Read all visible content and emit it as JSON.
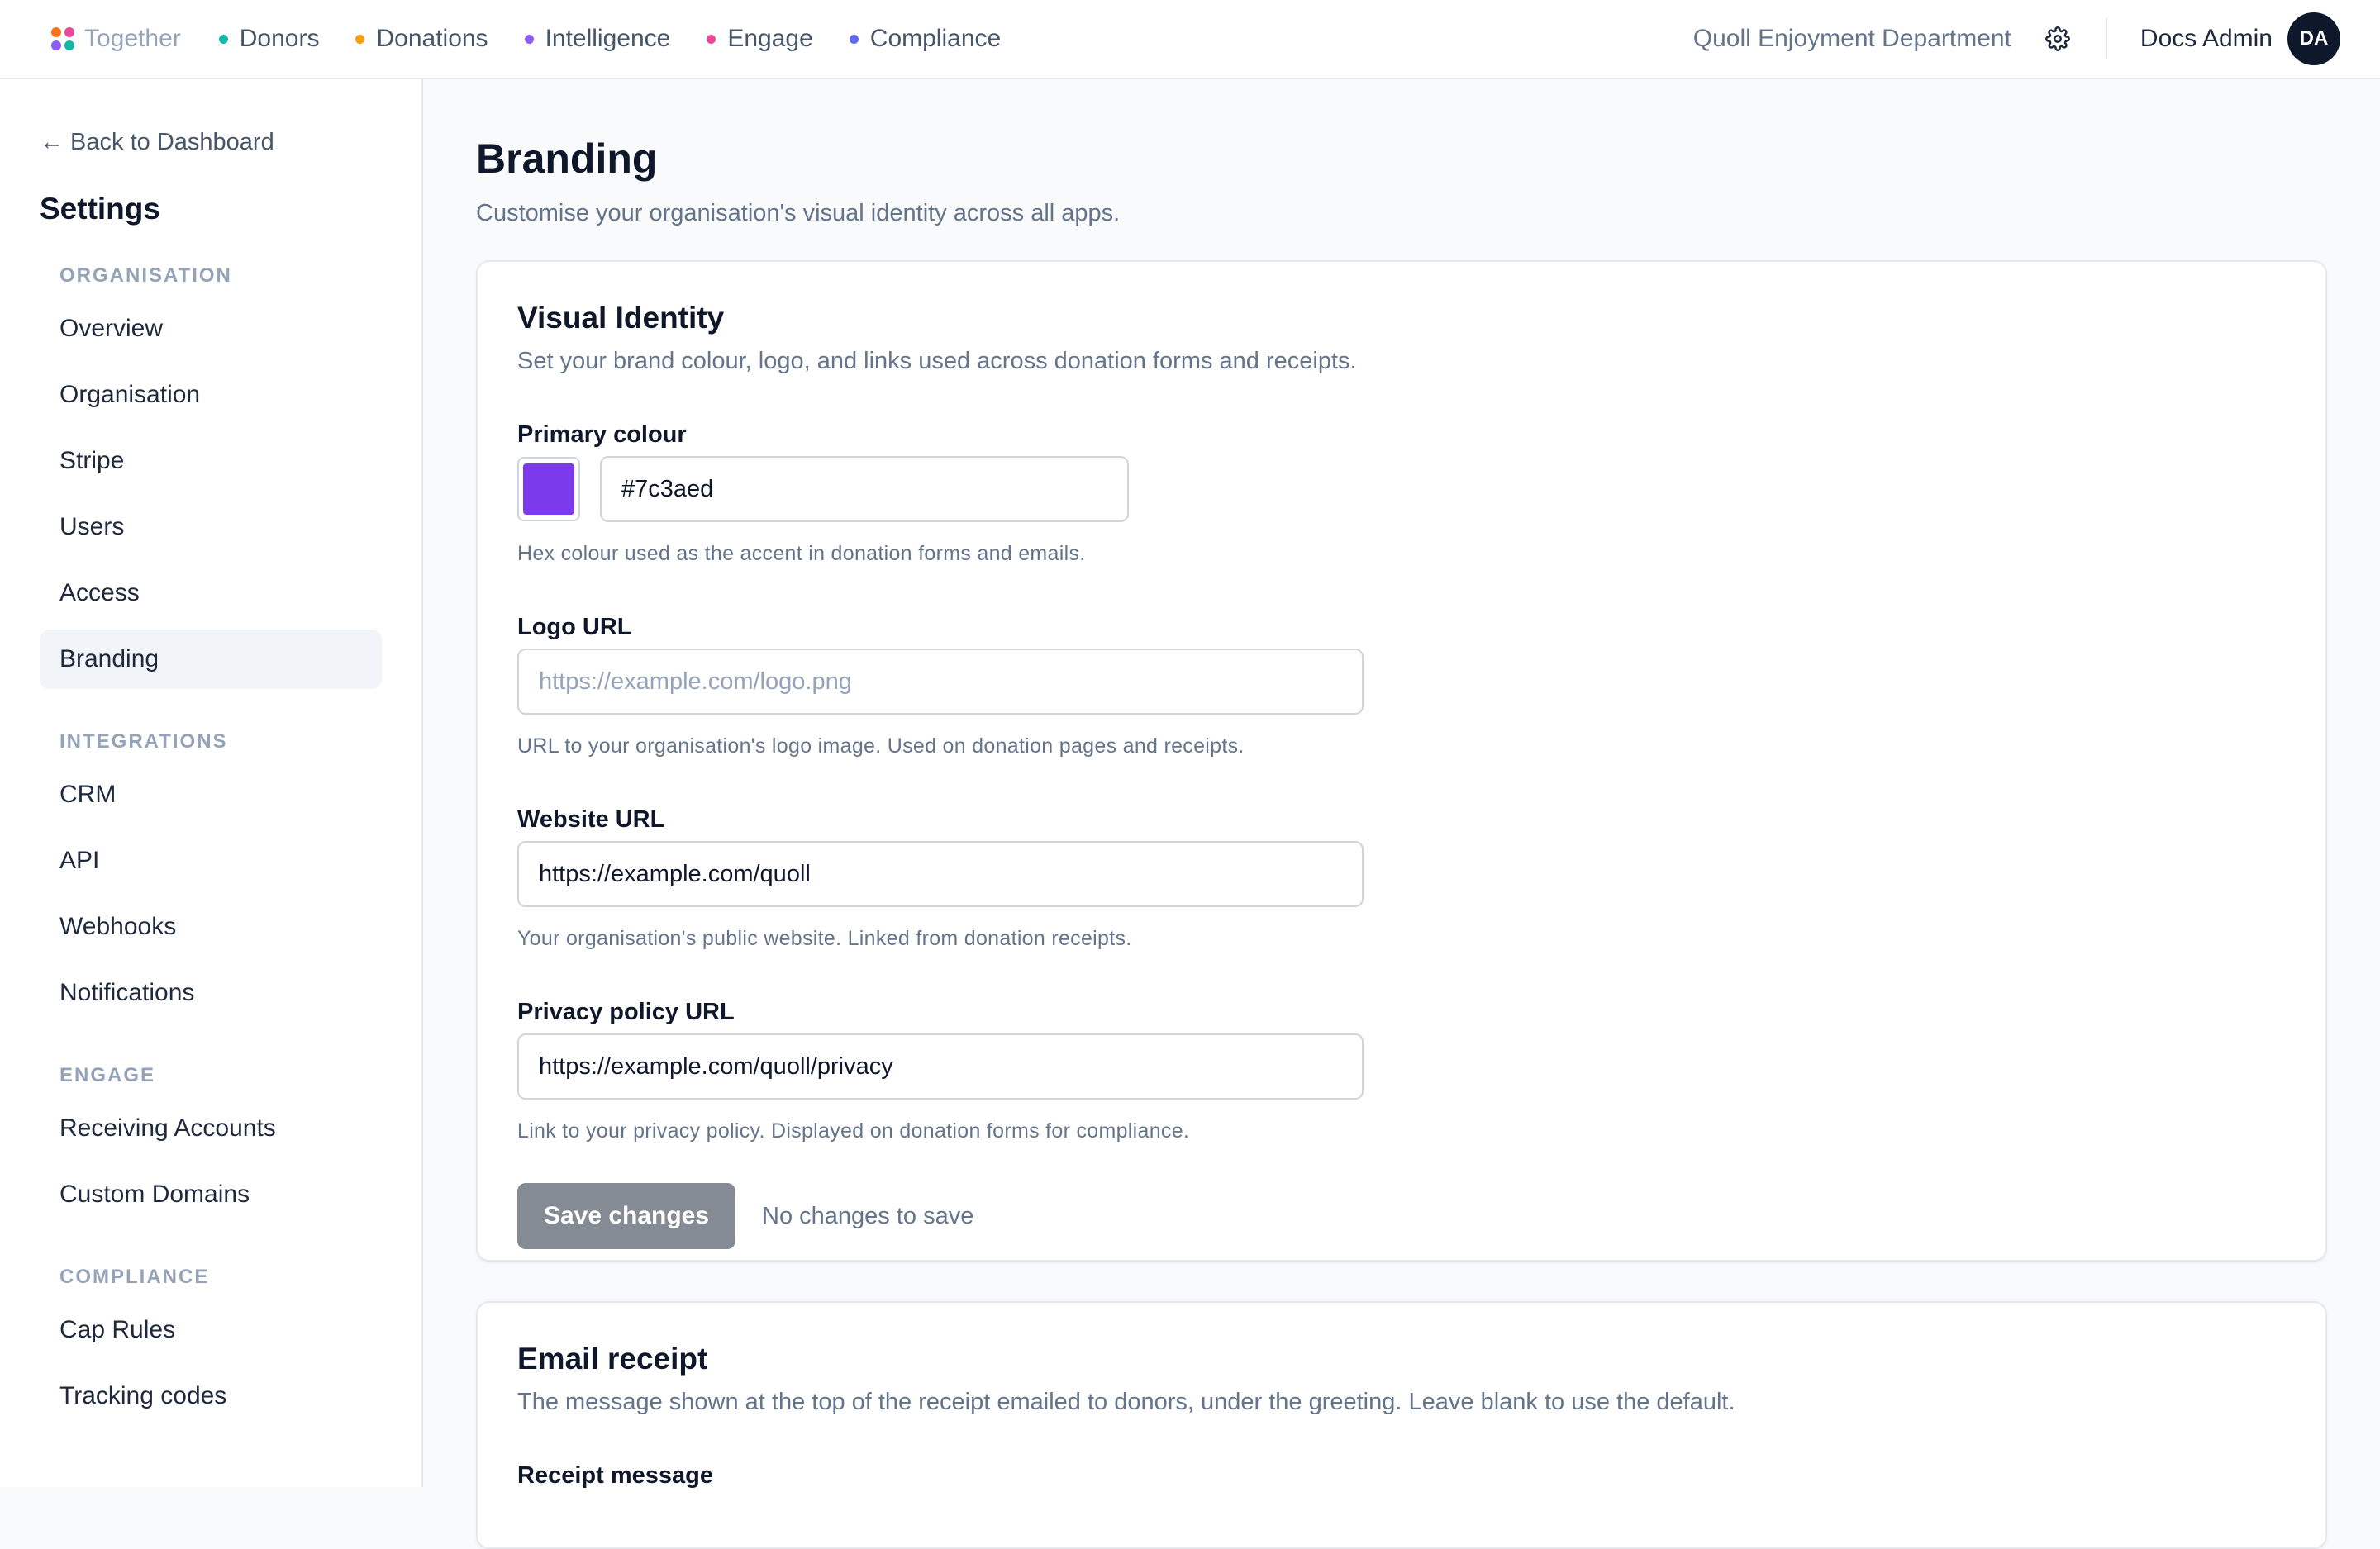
{
  "topbar": {
    "brand": "Together",
    "brand_dots": [
      "#f97316",
      "#ec4899",
      "#8b5cf6",
      "#14b8a6"
    ],
    "nav": [
      {
        "label": "Donors",
        "dot_color": "#14b8a6"
      },
      {
        "label": "Donations",
        "dot_color": "#f59e0b"
      },
      {
        "label": "Intelligence",
        "dot_color": "#8b5cf6"
      },
      {
        "label": "Engage",
        "dot_color": "#ec4899"
      },
      {
        "label": "Compliance",
        "dot_color": "#6366f1"
      }
    ],
    "org_name": "Quoll Enjoyment Department",
    "settings_icon": "gear-icon",
    "user_name": "Docs Admin",
    "avatar_initials": "DA"
  },
  "sidebar": {
    "back_link": "← Back to Dashboard",
    "title": "Settings",
    "sections": [
      {
        "label": "ORGANISATION",
        "items": [
          "Overview",
          "Organisation",
          "Stripe",
          "Users",
          "Access",
          "Branding"
        ]
      },
      {
        "label": "INTEGRATIONS",
        "items": [
          "CRM",
          "API",
          "Webhooks",
          "Notifications"
        ]
      },
      {
        "label": "ENGAGE",
        "items": [
          "Receiving Accounts",
          "Custom Domains"
        ]
      },
      {
        "label": "COMPLIANCE",
        "items": [
          "Cap Rules",
          "Tracking codes"
        ]
      }
    ],
    "active_item": "Branding"
  },
  "page": {
    "title": "Branding",
    "subtitle": "Customise your organisation's visual identity across all apps."
  },
  "visual_identity": {
    "title": "Visual Identity",
    "description": "Set your brand colour, logo, and links used across donation forms and receipts.",
    "primary_colour": {
      "label": "Primary colour",
      "value": "#7c3aed",
      "swatch_color": "#7c3aed",
      "hint": "Hex colour used as the accent in donation forms and emails."
    },
    "logo_url": {
      "label": "Logo URL",
      "value": "",
      "placeholder": "https://example.com/logo.png",
      "hint": "URL to your organisation's logo image. Used on donation pages and receipts."
    },
    "website_url": {
      "label": "Website URL",
      "value": "https://example.com/quoll",
      "hint": "Your organisation's public website. Linked from donation receipts."
    },
    "privacy_url": {
      "label": "Privacy policy URL",
      "value": "https://example.com/quoll/privacy",
      "hint": "Link to your privacy policy. Displayed on donation forms for compliance."
    },
    "save_label": "Save changes",
    "save_status": "No changes to save"
  },
  "email_receipt": {
    "title": "Email receipt",
    "description": "The message shown at the top of the receipt emailed to donors, under the greeting. Leave blank to use the default.",
    "receipt_message_label": "Receipt message"
  }
}
